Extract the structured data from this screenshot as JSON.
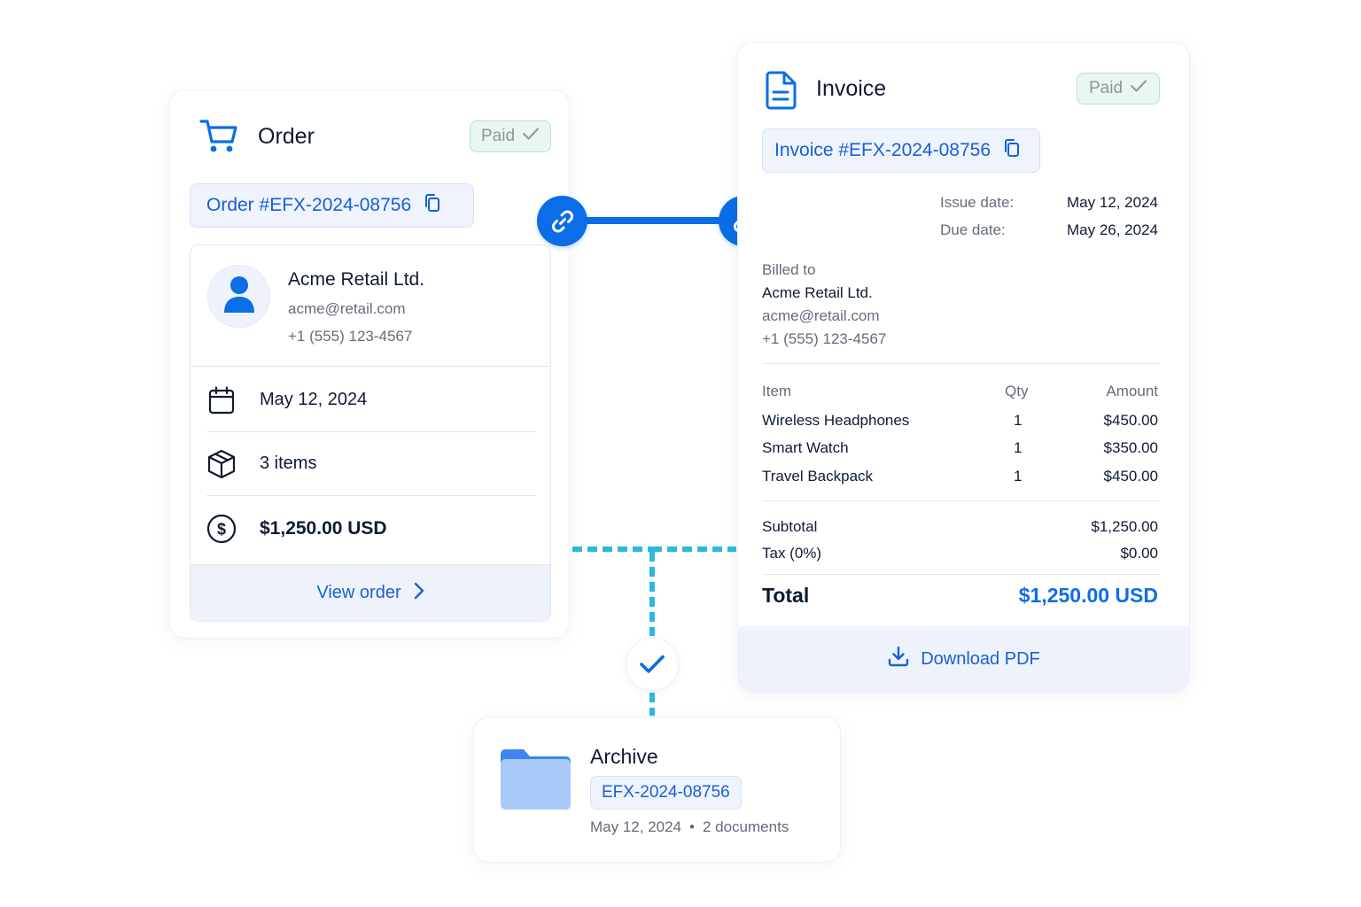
{
  "order": {
    "title": "Order",
    "status": "Paid",
    "order_id": "Order #EFX-2024-08756",
    "customer": {
      "name": "Acme Retail Ltd.",
      "email": "acme@retail.com",
      "phone": "+1 (555) 123-4567"
    },
    "date": "May 12, 2024",
    "items": "3 items",
    "total": "$1,250.00 USD",
    "view_label": "View order"
  },
  "invoice": {
    "title": "Invoice",
    "status": "Paid",
    "invoice_id": "Invoice #EFX-2024-08756",
    "issue_label": "Issue date:",
    "issue_date": "May 12, 2024",
    "due_label": "Due date:",
    "due_date": "May 26, 2024",
    "billed_label": "Billed to",
    "billed": {
      "name": "Acme Retail Ltd.",
      "email": "acme@retail.com",
      "phone": "+1 (555) 123-4567"
    },
    "columns": [
      "Item",
      "Qty",
      "Amount"
    ],
    "rows": [
      {
        "item": "Wireless Headphones",
        "qty": "1",
        "amount": "$450.00"
      },
      {
        "item": "Smart Watch",
        "qty": "1",
        "amount": "$350.00"
      },
      {
        "item": "Travel Backpack",
        "qty": "1",
        "amount": "$450.00"
      }
    ],
    "subtotal_label": "Subtotal",
    "subtotal": "$1,250.00",
    "tax_label": "Tax (0%)",
    "tax": "$0.00",
    "total_label": "Total",
    "total": "$1,250.00 USD",
    "download_label": "Download PDF"
  },
  "archive": {
    "title": "Archive",
    "archive_id": "EFX-2024-08756",
    "date": "May 12, 2024",
    "separator": "•",
    "documents": "2 documents"
  },
  "colors": {
    "accent": "#0b6de8",
    "link_blue": "#1a5fd6",
    "dashed": "#2bb8e3",
    "paid_bg": "#e9f7f0"
  },
  "icons": {
    "order": "cart-icon",
    "invoice": "document-icon",
    "archive": "folder-icon",
    "link": "link-icon",
    "check": "check-icon"
  }
}
